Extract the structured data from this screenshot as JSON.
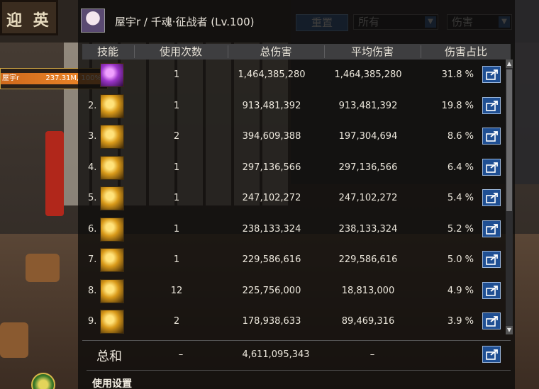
{
  "scene": {
    "sign_text": "迎 英"
  },
  "left_entry": {
    "name": "屋宇r",
    "value": "237.31M, 100%",
    "bar_fill": 1.0
  },
  "options": {
    "reset_label": "重置",
    "filter_select": "所有",
    "type_select": "伤害"
  },
  "window": {
    "title": "屋宇r / 千魂·征战者 (Lv.100)",
    "columns": {
      "skill": "技能",
      "uses": "使用次数",
      "total": "总伤害",
      "avg": "平均伤害",
      "share": "伤害占比"
    },
    "rows": [
      {
        "num": "",
        "uses": "1",
        "total": "1,464,385,280",
        "avg": "1,464,385,280",
        "pct": "31.8 %",
        "icon": "purple-slash-skill-icon"
      },
      {
        "num": "2.",
        "uses": "1",
        "total": "913,481,392",
        "avg": "913,481,392",
        "pct": "19.8 %",
        "icon": "flame-dash-skill-icon"
      },
      {
        "num": "3.",
        "uses": "2",
        "total": "394,609,388",
        "avg": "197,304,694",
        "pct": "8.6 %",
        "icon": "gold-strike-skill-icon"
      },
      {
        "num": "4.",
        "uses": "1",
        "total": "297,136,566",
        "avg": "297,136,566",
        "pct": "6.4 %",
        "icon": "gold-pillar-skill-icon"
      },
      {
        "num": "5.",
        "uses": "1",
        "total": "247,102,272",
        "avg": "247,102,272",
        "pct": "5.4 %",
        "icon": "gold-wind-skill-icon"
      },
      {
        "num": "6.",
        "uses": "1",
        "total": "238,133,324",
        "avg": "238,133,324",
        "pct": "5.2 %",
        "icon": "gold-slash-skill-icon"
      },
      {
        "num": "7.",
        "uses": "1",
        "total": "229,586,616",
        "avg": "229,586,616",
        "pct": "5.0 %",
        "icon": "gold-burst-skill-icon"
      },
      {
        "num": "8.",
        "uses": "12",
        "total": "225,756,000",
        "avg": "18,813,000",
        "pct": "4.9 %",
        "icon": "gold-lance-skill-icon"
      },
      {
        "num": "9.",
        "uses": "2",
        "total": "178,938,633",
        "avg": "89,469,316",
        "pct": "3.9 %",
        "icon": "gold-crescent-skill-icon"
      }
    ],
    "total": {
      "label": "总和",
      "uses": "–",
      "total": "4,611,095,343",
      "avg": "–"
    },
    "section_title": "使用设置"
  },
  "colors": {
    "header_bg": "#3e3e40",
    "share_button": "#1f4f93",
    "accent_orange": "#e07a22"
  }
}
